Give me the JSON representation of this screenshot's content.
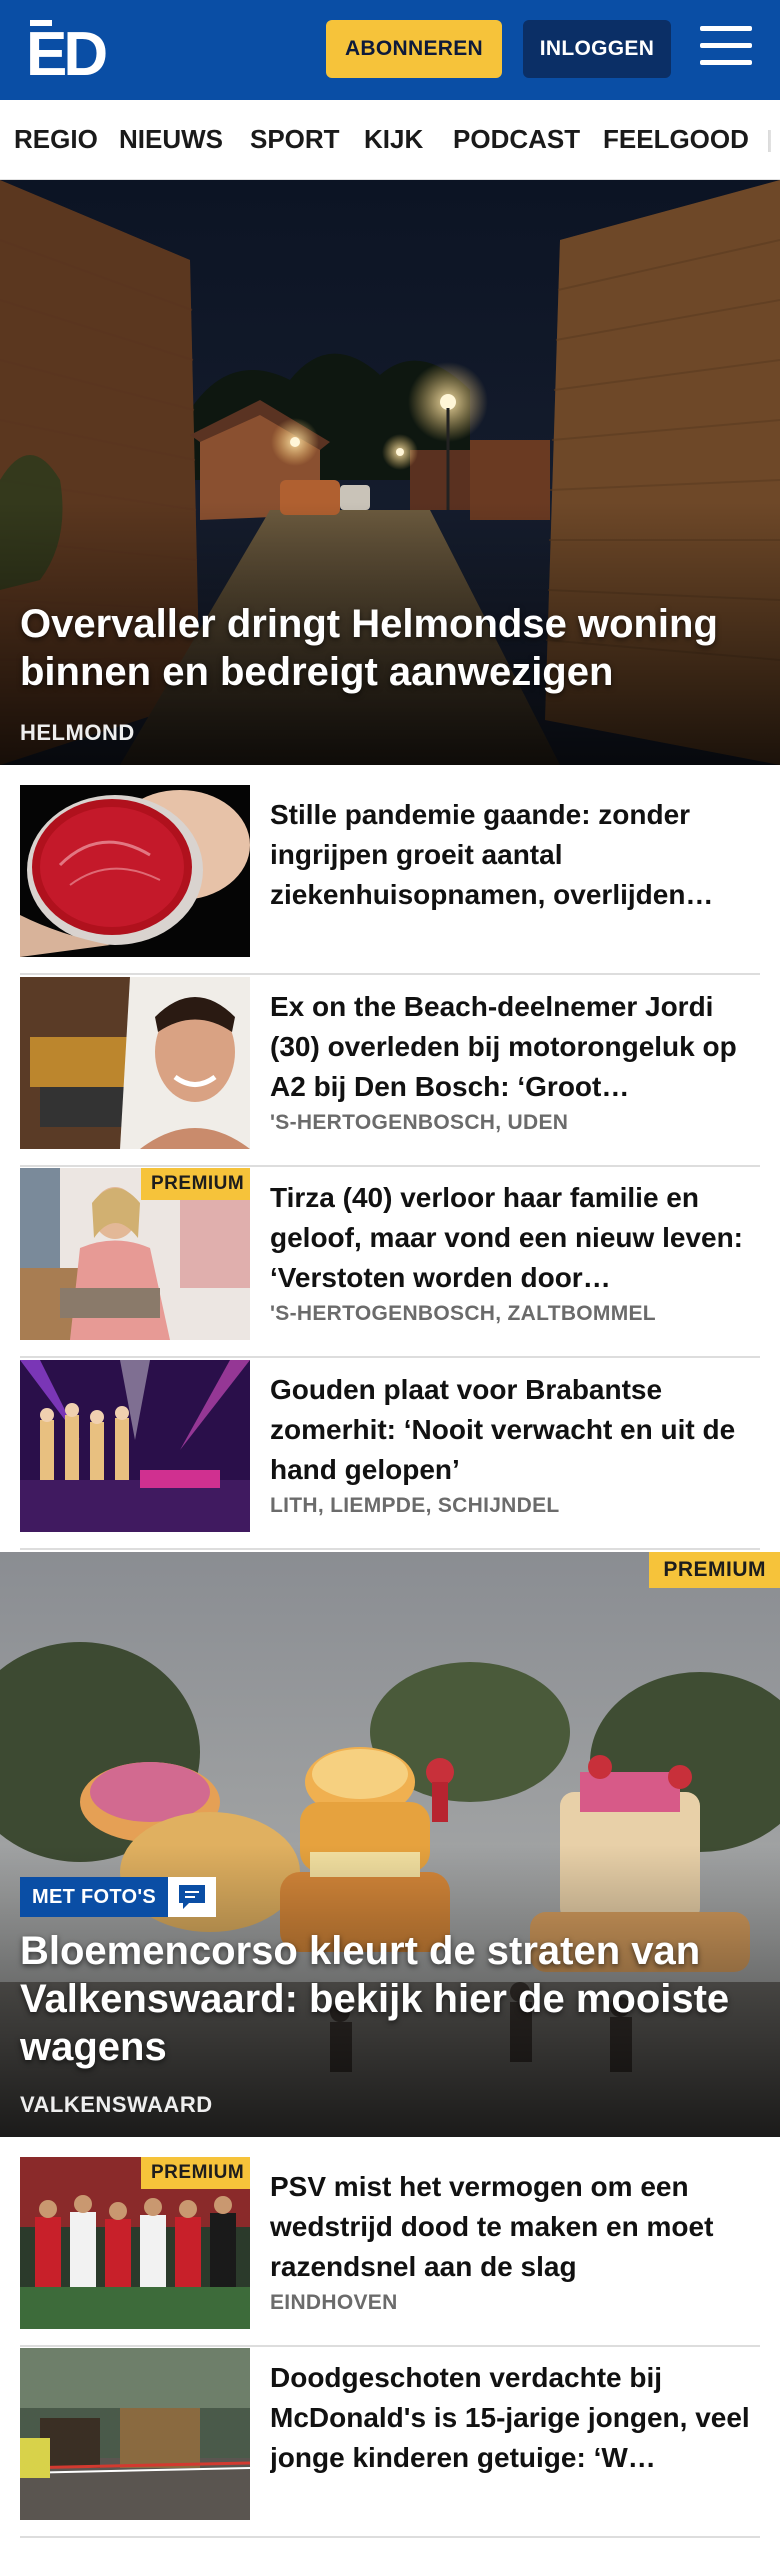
{
  "header": {
    "logo": "ED",
    "subscribe_label": "ABONNEREN",
    "login_label": "INLOGGEN",
    "menu_icon": "hamburger-menu-icon",
    "brand_color": "#0a4ea5",
    "accent_color": "#f6c33a"
  },
  "nav": {
    "items": [
      "REGIO",
      "NIEUWS",
      "SPORT",
      "KIJK",
      "PODCAST",
      "FEELGOOD"
    ]
  },
  "hero": {
    "title": "Overvaller dringt Helmondse woning binnen en bedreigt aanwezigen",
    "location": "HELMOND"
  },
  "articles": [
    {
      "title": "Stille pandemie gaande: zonder ingrijpen groeit aantal ziekenhuisopnamen, overlijden…",
      "location": "",
      "badge": ""
    },
    {
      "title": "Ex on the Beach-deelnemer Jordi (30) overleden bij motorongeluk op A2 bij Den Bosch: ‘Groot…",
      "location": "'S-HERTOGENBOSCH, UDEN",
      "badge": ""
    },
    {
      "title": "Tirza (40) verloor haar familie en geloof, maar vond een nieuw leven: ‘Verstoten worden door…",
      "location": "'S-HERTOGENBOSCH, ZALTBOMMEL",
      "badge": "PREMIUM"
    },
    {
      "title": "Gouden plaat voor Brabantse zomerhit: ‘Nooit verwacht en uit de hand gelopen’",
      "location": "LITH, LIEMPDE, SCHIJNDEL",
      "badge": ""
    }
  ],
  "hero2": {
    "badge": "PREMIUM",
    "tag": "MET FOTO'S",
    "tag_icon": "comment-icon",
    "title": "Bloemencorso kleurt de straten van Valkenswaard: bekijk hier de mooiste wagens",
    "location": "VALKENSWAARD"
  },
  "articles2": [
    {
      "title": "PSV mist het vermogen om een wedstrijd dood te maken en moet razendsnel aan de slag",
      "location": "EINDHOVEN",
      "badge": "PREMIUM"
    },
    {
      "title": "Doodgeschoten verdachte bij McDonald's is 15-jarige jongen, veel jonge kinderen getuige: ‘W…",
      "location": "",
      "badge": ""
    }
  ]
}
